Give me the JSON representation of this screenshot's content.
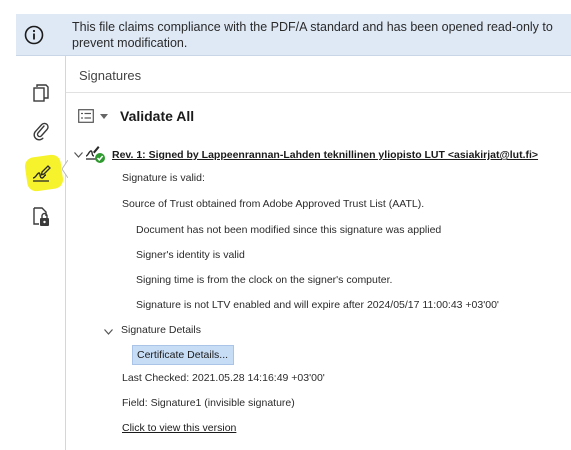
{
  "banner": {
    "text": "This file claims compliance with the PDF/A standard and has been opened read-only to prevent modification.",
    "icon": "info-icon"
  },
  "rail": {
    "items": [
      {
        "icon": "pages-icon"
      },
      {
        "icon": "paperclip-icon"
      },
      {
        "icon": "signature-pen-icon",
        "active": true
      },
      {
        "icon": "document-lock-icon"
      }
    ],
    "highlight_color": "#f6f32c"
  },
  "panel": {
    "title": "Signatures",
    "validate_all_label": "Validate All"
  },
  "signature": {
    "header": "Rev. 1: Signed by Lappeenrannan-Lahden teknillinen yliopisto LUT <asiakirjat@lut.fi>",
    "lines": [
      "Signature is valid:",
      "Source of Trust obtained from Adobe Approved Trust List (AATL).",
      "Document has not been modified since this signature was applied",
      "Signer's identity is valid",
      "Signing time is from the clock on the signer's computer.",
      "Signature is not LTV enabled and will expire after 2024/05/17 11:00:43 +03'00'"
    ],
    "details_label": "Signature Details",
    "certificate_button": "Certificate Details...",
    "last_checked": "Last Checked: 2021.05.28 14:16:49 +03'00'",
    "field": "Field: Signature1 (invisible signature)",
    "view_version_link": "Click to view this version"
  }
}
